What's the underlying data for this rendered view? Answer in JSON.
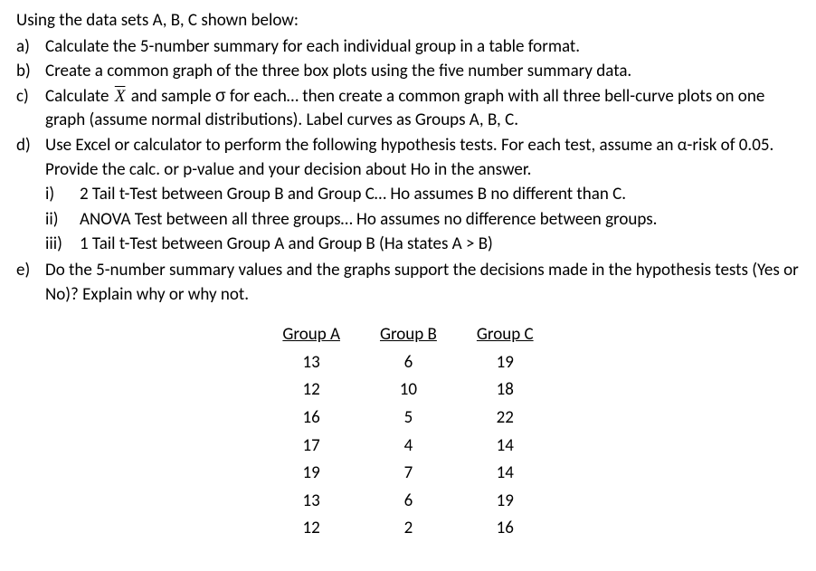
{
  "intro": "Using the data sets A, B, C shown below:",
  "questions": {
    "a": {
      "marker": "a)",
      "text": "Calculate the 5-number summary for each individual group in a table format."
    },
    "b": {
      "marker": "b)",
      "text": "Create a common graph of the three box plots using the five number summary data."
    },
    "c": {
      "marker": "c)",
      "text_before": "Calculate ",
      "xbar": "X",
      "text_mid": " and sample ",
      "sigma": "σ",
      "text_after": " for each… then create a common graph with all three bell-curve plots on one graph (assume normal distributions). Label curves as Groups A, B, C."
    },
    "d": {
      "marker": "d)",
      "text": "Use Excel or calculator to perform the following hypothesis tests. For each test, assume an α-risk of 0.05. Provide the calc. or p-value and your decision about Ho in the answer.",
      "sub": {
        "i": {
          "marker": "i)",
          "text": "2 Tail t-Test between Group B and Group C… Ho assumes B no different than C."
        },
        "ii": {
          "marker": "ii)",
          "text": "ANOVA Test between all three groups… Ho assumes no difference between groups."
        },
        "iii": {
          "marker": "iii)",
          "text": "1 Tail t-Test between Group A and Group B (Ha states A > B)"
        }
      }
    },
    "e": {
      "marker": "e)",
      "text": "Do the 5-number summary values and the graphs support the decisions made in the hypothesis tests (Yes or No)? Explain why or why not."
    }
  },
  "table": {
    "headers": {
      "a": "Group A",
      "b": "Group B",
      "c": "Group C"
    },
    "rows": [
      {
        "a": "13",
        "b": "6",
        "c": "19"
      },
      {
        "a": "12",
        "b": "10",
        "c": "18"
      },
      {
        "a": "16",
        "b": "5",
        "c": "22"
      },
      {
        "a": "17",
        "b": "4",
        "c": "14"
      },
      {
        "a": "19",
        "b": "7",
        "c": "14"
      },
      {
        "a": "13",
        "b": "6",
        "c": "19"
      },
      {
        "a": "12",
        "b": "2",
        "c": "16"
      }
    ]
  },
  "chart_data": {
    "type": "table",
    "title": "Data sets A, B, C",
    "series": [
      {
        "name": "Group A",
        "values": [
          13,
          12,
          16,
          17,
          19,
          13,
          12
        ]
      },
      {
        "name": "Group B",
        "values": [
          6,
          10,
          5,
          4,
          7,
          6,
          2
        ]
      },
      {
        "name": "Group C",
        "values": [
          19,
          18,
          22,
          14,
          14,
          19,
          16
        ]
      }
    ]
  }
}
